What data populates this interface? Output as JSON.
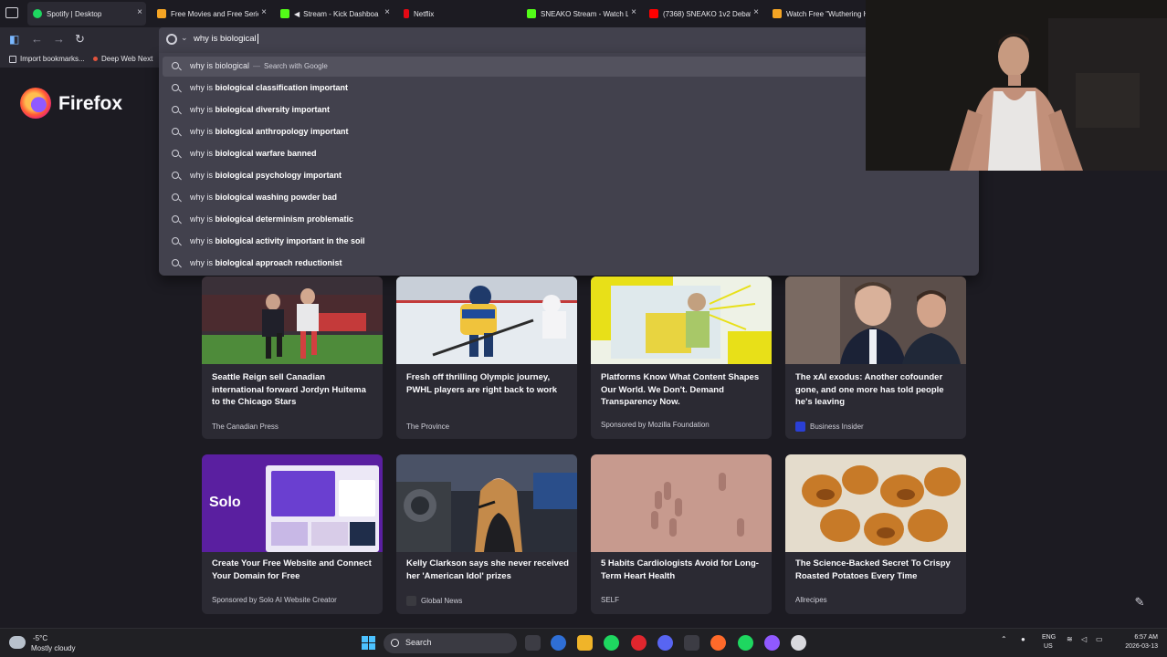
{
  "browser": {
    "name": "Firefox"
  },
  "tabs": [
    {
      "label": "Spotify | Desktop",
      "icon": "spotify-icon",
      "color": "#1ed760",
      "close": "×"
    },
    {
      "label": "Free Movies and Free Serie",
      "icon": "movies-site-icon",
      "color": "#f5a524",
      "close": "×"
    },
    {
      "label": "Stream - Kick Dashboa",
      "icon": "kick-icon",
      "color": "#53fc18",
      "close": "×",
      "audio": "speaker-icon"
    },
    {
      "label": "Netflix",
      "icon": "netflix-icon",
      "color": "#e50914",
      "close": "×"
    },
    {
      "label": "SNEAKO Stream - Watch Li",
      "icon": "kick-icon",
      "color": "#53fc18",
      "close": "×"
    },
    {
      "label": "(7368) SNEAKO 1v2 Debat",
      "icon": "youtube-icon",
      "color": "#ff0000",
      "close": "×"
    },
    {
      "label": "Watch Free \"Wuthering H",
      "icon": "movies-site-icon",
      "color": "#f5a524",
      "close": ""
    }
  ],
  "urlbar": {
    "value": "why is biological"
  },
  "bookmarks": [
    {
      "label": "Import bookmarks...",
      "icon": "import-icon"
    },
    {
      "label": "Deep Web Next",
      "icon": "bookmark-icon"
    }
  ],
  "suggestions": [
    {
      "prefix": "why is biological",
      "bold": "",
      "separator": "—",
      "action": "Search with Google"
    },
    {
      "prefix": "why is ",
      "bold": "biological classification important"
    },
    {
      "prefix": "why is ",
      "bold": "biological diversity important"
    },
    {
      "prefix": "why is ",
      "bold": "biological anthropology important"
    },
    {
      "prefix": "why is ",
      "bold": "biological warfare banned"
    },
    {
      "prefix": "why is ",
      "bold": "biological psychology important"
    },
    {
      "prefix": "why is ",
      "bold": "biological washing powder bad"
    },
    {
      "prefix": "why is ",
      "bold": "biological determinism problematic"
    },
    {
      "prefix": "why is ",
      "bold": "biological activity important in the soil"
    },
    {
      "prefix": "why is ",
      "bold": "biological approach reductionist"
    }
  ],
  "stories": [
    {
      "title": "Seattle Reign sell Canadian international forward Jordyn Huitema to the Chicago Stars",
      "source": "The Canadian Press",
      "image": "soccer-photo"
    },
    {
      "title": "Fresh off thrilling Olympic journey, PWHL players are right back to work",
      "source": "The Province",
      "image": "hockey-photo"
    },
    {
      "title": "Platforms Know What Content Shapes Our World. We Don't. Demand Transparency Now.",
      "source": "Sponsored by Mozilla Foundation",
      "image": "illustration-photo"
    },
    {
      "title": "The xAI exodus: Another cofounder gone, and one more has told people he's leaving",
      "source": "Business Insider",
      "source_icon": "business-insider-icon",
      "image": "people-photo"
    },
    {
      "title": "Create Your Free Website and Connect Your Domain for Free",
      "source": "Sponsored by Solo AI Website Creator",
      "image": "solo-ad",
      "image_text": "Solo"
    },
    {
      "title": "Kelly Clarkson says she never received her 'American Idol' prizes",
      "source": "Global News",
      "source_icon": "global-news-icon",
      "image": "singer-photo"
    },
    {
      "title": "5 Habits Cardiologists Avoid for Long-Term Heart Health",
      "source": "SELF",
      "image": "pills-photo"
    },
    {
      "title": "The Science-Backed Secret To Crispy Roasted Potatoes Every Time",
      "source": "Allrecipes",
      "image": "potatoes-photo"
    }
  ],
  "taskbar": {
    "weather": {
      "temp": "-5°C",
      "desc": "Mostly cloudy"
    },
    "search_label": "Search",
    "lang": [
      "ENG",
      "US"
    ],
    "time": "6:57 AM",
    "date": "2026-03-13"
  },
  "colors": {
    "accent": "#7ab8ff",
    "surface": "#2b2a33",
    "background": "#1c1b22",
    "urlbar": "#42414d"
  }
}
